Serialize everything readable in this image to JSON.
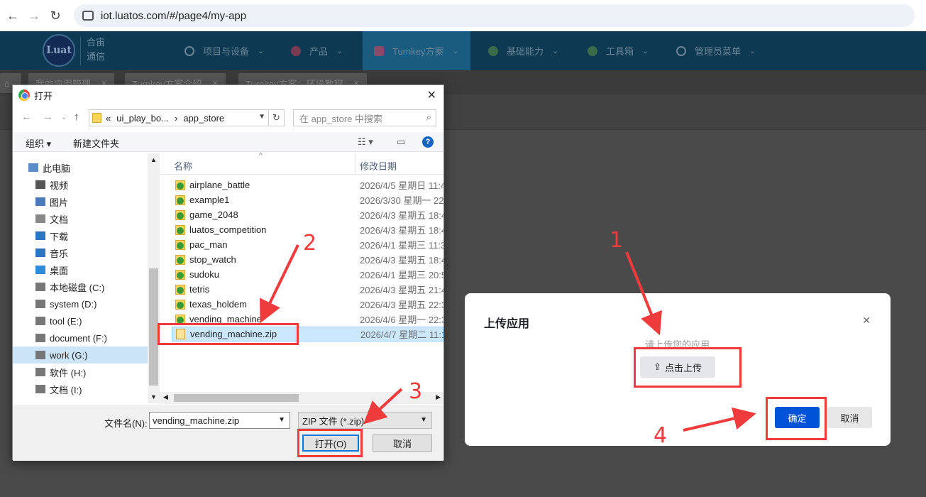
{
  "browser": {
    "url": "iot.luatos.com/#/page4/my-app"
  },
  "app_header": {
    "logo_text": "Luat",
    "brand_line1": "合宙",
    "brand_line2": "通信",
    "menu": [
      {
        "label": "项目与设备"
      },
      {
        "label": "产品"
      },
      {
        "label": "Turnkey方案"
      },
      {
        "label": "基础能力"
      },
      {
        "label": "工具箱"
      },
      {
        "label": "管理员菜单"
      }
    ]
  },
  "tabs": [
    {
      "label": "我的应用管理"
    },
    {
      "label": "Turnkey方案介绍"
    },
    {
      "label": "Turnkey方案：环境教程"
    }
  ],
  "file_dialog": {
    "title": "打开",
    "path": [
      "«",
      "ui_play_bo...",
      "›",
      "app_store"
    ],
    "search_placeholder": "在 app_store 中搜索",
    "toolbar": {
      "organize": "组织",
      "new_folder": "新建文件夹"
    },
    "nav_items": [
      {
        "label": "此电脑",
        "icon": "pc-icon"
      },
      {
        "label": "视频",
        "icon": "video-icon"
      },
      {
        "label": "图片",
        "icon": "picture-icon"
      },
      {
        "label": "文档",
        "icon": "document-icon"
      },
      {
        "label": "下载",
        "icon": "download-icon"
      },
      {
        "label": "音乐",
        "icon": "music-icon"
      },
      {
        "label": "桌面",
        "icon": "desktop-icon"
      },
      {
        "label": "本地磁盘 (C:)",
        "icon": "drive-icon"
      },
      {
        "label": "system (D:)",
        "icon": "drive-icon"
      },
      {
        "label": "tool (E:)",
        "icon": "drive-icon"
      },
      {
        "label": "document (F:)",
        "icon": "drive-icon"
      },
      {
        "label": "work (G:)",
        "icon": "drive-icon"
      },
      {
        "label": "软件 (H:)",
        "icon": "drive-icon"
      },
      {
        "label": "文档 (I:)",
        "icon": "drive-icon"
      }
    ],
    "columns": {
      "name": "名称",
      "date": "修改日期"
    },
    "files": [
      {
        "name": "airplane_battle",
        "date": "2026/4/5 星期日 11:4"
      },
      {
        "name": "example1",
        "date": "2026/3/30 星期一 22:"
      },
      {
        "name": "game_2048",
        "date": "2026/4/3 星期五 18:4"
      },
      {
        "name": "luatos_competition",
        "date": "2026/4/3 星期五 18:4"
      },
      {
        "name": "pac_man",
        "date": "2026/4/1 星期三 11:3"
      },
      {
        "name": "stop_watch",
        "date": "2026/4/3 星期五 18:4"
      },
      {
        "name": "sudoku",
        "date": "2026/4/1 星期三 20:5"
      },
      {
        "name": "tetris",
        "date": "2026/4/3 星期五 21:4"
      },
      {
        "name": "texas_holdem",
        "date": "2026/4/3 星期五 22:3"
      },
      {
        "name": "vending_machine",
        "date": "2026/4/6 星期一 22:3"
      },
      {
        "name": "vending_machine.zip",
        "date": "2026/4/7 星期二 11:1"
      }
    ],
    "filename_label": "文件名(N):",
    "filename_value": "vending_machine.zip",
    "filetype_value": "ZIP 文件 (*.zip)",
    "open_label": "打开(O)",
    "cancel_label": "取消"
  },
  "upload_dialog": {
    "title": "上传应用",
    "hint": "请上传您的应用",
    "upload_label": "点击上传",
    "confirm_label": "确定",
    "cancel_label": "取消"
  },
  "annotations": {
    "step1": "1",
    "step2": "2",
    "step3": "3",
    "step4": "4"
  },
  "colors": {
    "highlight": "#ef3b3b",
    "primary": "#0052d9",
    "header_bg": "#0d3a52"
  }
}
